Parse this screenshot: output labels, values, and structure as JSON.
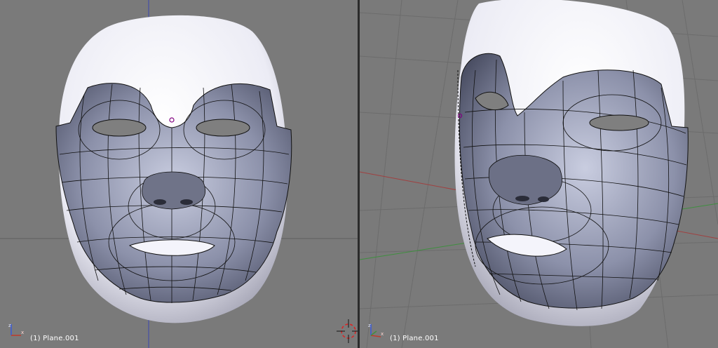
{
  "viewports": [
    {
      "id": "left",
      "view": "front-ortho",
      "object_label": "(1) Plane.001",
      "grid": true,
      "axis_gizmo": {
        "axes": [
          "z",
          "x"
        ],
        "colors": {
          "x": "#c0392b",
          "z": "#3a5bd9"
        }
      }
    },
    {
      "id": "right",
      "view": "user-perspective",
      "object_label": "(1) Plane.001",
      "grid": true,
      "axis_gizmo": {
        "axes": [
          "z",
          "x"
        ],
        "colors": {
          "x": "#c0392b",
          "z": "#3a5bd9"
        }
      }
    }
  ],
  "colors": {
    "viewport_bg": "#7a7a7a",
    "grid_line": "#6a6a6a",
    "mesh_fill": "#8b90a8",
    "mesh_wire": "#111111",
    "head_white": "#f4f4fb"
  }
}
